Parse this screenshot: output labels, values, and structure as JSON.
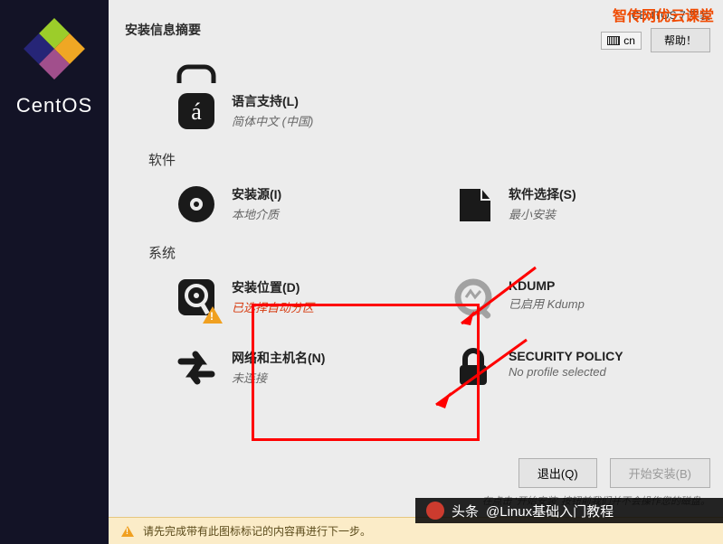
{
  "sidebar": {
    "brand": "CentOS"
  },
  "header": {
    "title": "安装信息摘要",
    "version": "CENTOS 7 安装",
    "watermark": "智传网优云课堂",
    "keyboard": "cn",
    "help": "帮助！"
  },
  "spoke_lang": {
    "label": "语言支持(L)",
    "sub": "简体中文 (中国)"
  },
  "section_software": "软件",
  "spoke_source": {
    "label": "安装源(I)",
    "sub": "本地介质"
  },
  "spoke_selection": {
    "label": "软件选择(S)",
    "sub": "最小安装"
  },
  "section_system": "系统",
  "spoke_dest": {
    "label": "安装位置(D)",
    "sub": "已选择自动分区"
  },
  "spoke_kdump": {
    "label": "KDUMP",
    "sub": "已启用 Kdump"
  },
  "spoke_net": {
    "label": "网络和主机名(N)",
    "sub": "未连接"
  },
  "spoke_sec": {
    "label": "SECURITY POLICY",
    "sub": "No profile selected"
  },
  "footer": {
    "quit": "退出(Q)",
    "begin": "开始安装(B)",
    "hint": "在点击 '开始安装' 按钮前我们并不会操作您的磁盘。"
  },
  "warnbar": "请先完成带有此图标标记的内容再进行下一步。",
  "overlay": {
    "prefix": "头条",
    "text": "@Linux基础入门教程"
  }
}
